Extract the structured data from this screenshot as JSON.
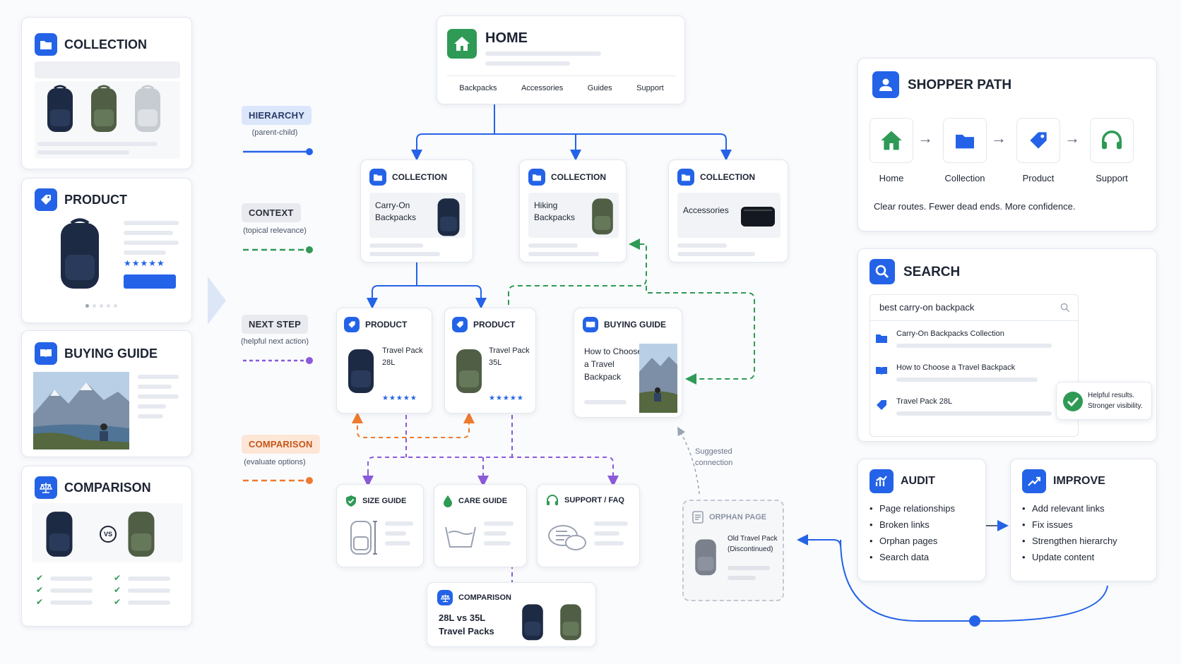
{
  "left": {
    "collection": {
      "title": "COLLECTION"
    },
    "product": {
      "title": "PRODUCT"
    },
    "guide": {
      "title": "BUYING GUIDE"
    },
    "comparison": {
      "title": "COMPARISON",
      "vs": "VS"
    }
  },
  "legend": [
    {
      "title": "HIERARCHY",
      "sub": "(parent-child)",
      "color": "#2463e8"
    },
    {
      "title": "CONTEXT",
      "sub": "(topical relevance)",
      "color": "#2e9a55"
    },
    {
      "title": "NEXT STEP",
      "sub": "(helpful next action)",
      "color": "#8a5ad8"
    },
    {
      "title": "COMPARISON",
      "sub": "(evaluate options)",
      "color": "#ee7a2f"
    }
  ],
  "home": {
    "title": "HOME",
    "nav": [
      "Backpacks",
      "Accessories",
      "Guides",
      "Support"
    ]
  },
  "collections": [
    {
      "tag": "COLLECTION",
      "name": "Carry-On Backpacks"
    },
    {
      "tag": "COLLECTION",
      "name": "Hiking Backpacks"
    },
    {
      "tag": "COLLECTION",
      "name": "Accessories"
    }
  ],
  "products": [
    {
      "tag": "PRODUCT",
      "name": "Travel Pack 28L",
      "stars": "★★★★★"
    },
    {
      "tag": "PRODUCT",
      "name": "Travel Pack 35L",
      "stars": "★★★★★"
    }
  ],
  "buying_guide": {
    "tag": "BUYING GUIDE",
    "name": "How to Choose a Travel Backpack"
  },
  "suggested": "Suggested connection",
  "support_cards": [
    {
      "tag": "SIZE GUIDE"
    },
    {
      "tag": "CARE GUIDE"
    },
    {
      "tag": "SUPPORT / FAQ"
    }
  ],
  "comparison_card": {
    "tag": "COMPARISON",
    "name": "28L vs 35L Travel Packs"
  },
  "orphan": {
    "tag": "ORPHAN PAGE",
    "name": "Old Travel Pack",
    "sub": "(Discontinued)"
  },
  "shopper": {
    "title": "SHOPPER PATH",
    "steps": [
      "Home",
      "Collection",
      "Product",
      "Support"
    ],
    "caption": "Clear routes. Fewer dead ends. More confidence."
  },
  "search": {
    "title": "SEARCH",
    "query": "best carry-on backpack",
    "results": [
      "Carry-On Backpacks Collection",
      "How to Choose a Travel Backpack",
      "Travel Pack 28L"
    ],
    "callout": "Helpful results. Stronger visibility."
  },
  "audit": {
    "title": "AUDIT",
    "items": [
      "Page relationships",
      "Broken links",
      "Orphan pages",
      "Search data"
    ]
  },
  "improve": {
    "title": "IMPROVE",
    "items": [
      "Add relevant links",
      "Fix issues",
      "Strengthen hierarchy",
      "Update content"
    ]
  },
  "colors": {
    "blue": "#2463e8",
    "green": "#2e9a55",
    "purple": "#8a5ad8",
    "orange": "#ee7a2f",
    "home_green": "#2e9a55"
  }
}
